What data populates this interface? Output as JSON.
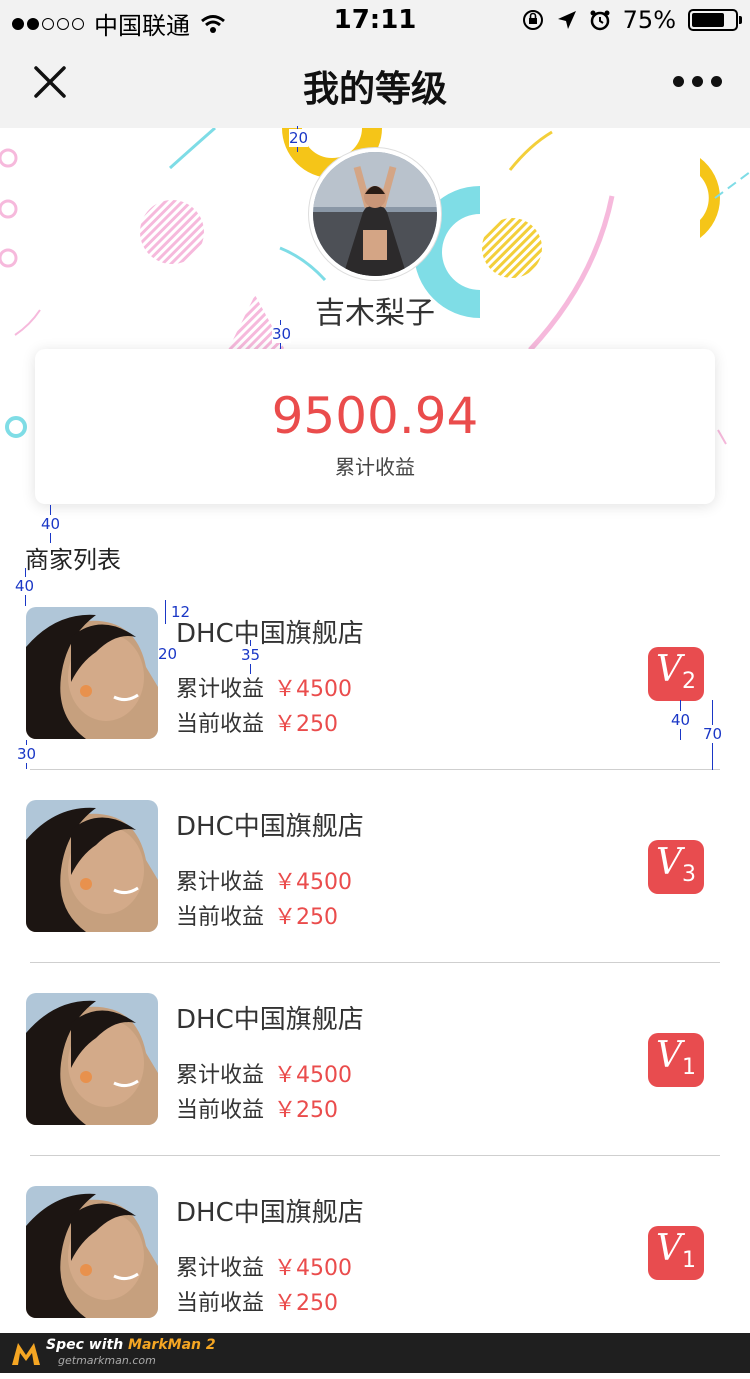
{
  "statusbar": {
    "carrier": "中国联通",
    "time": "17:11",
    "battery": "75%"
  },
  "nav": {
    "title": "我的等级"
  },
  "profile": {
    "name": "吉木梨子"
  },
  "summary": {
    "value": "9500.94",
    "label": "累计收益"
  },
  "section": {
    "title": "商家列表"
  },
  "merchants": [
    {
      "name": "DHC中国旗舰店",
      "total_label": "累计收益",
      "total": "￥4500",
      "current_label": "当前收益",
      "current": "￥250",
      "level": "2"
    },
    {
      "name": "DHC中国旗舰店",
      "total_label": "累计收益",
      "total": "￥4500",
      "current_label": "当前收益",
      "current": "￥250",
      "level": "3"
    },
    {
      "name": "DHC中国旗舰店",
      "total_label": "累计收益",
      "total": "￥4500",
      "current_label": "当前收益",
      "current": "￥250",
      "level": "1"
    },
    {
      "name": "DHC中国旗舰店",
      "total_label": "累计收益",
      "total": "￥4500",
      "current_label": "当前收益",
      "current": "￥250",
      "level": "1"
    }
  ],
  "badge_letter": "V",
  "spec_marks": {
    "m1": "20",
    "m2": "30",
    "m3": "40",
    "m4": "40",
    "m5": "12",
    "m6": "20",
    "m7": "35",
    "m8": "40",
    "m9": "70",
    "m10": "30"
  },
  "footer": {
    "prefix": "Spec with ",
    "brand": "MarkMan 2",
    "url": "getmarkman.com"
  },
  "colors": {
    "accent": "#ea4c4c",
    "badge": "#e84c4f",
    "nav_bg": "#f2f2f2"
  }
}
